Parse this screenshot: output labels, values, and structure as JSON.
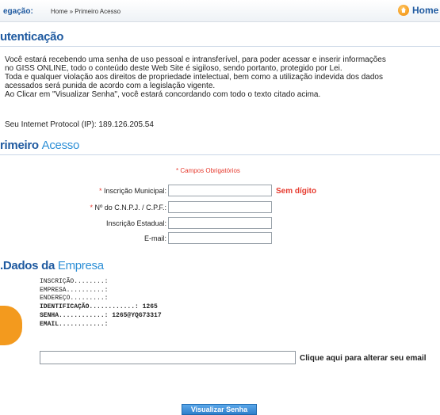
{
  "topbar": {
    "nav_label": "egação:",
    "breadcrumb": "Home » Primeiro Acesso",
    "home_label": "Home"
  },
  "auth": {
    "title": "utenticação",
    "paragraph_lines": [
      "Você estará recebendo uma senha de uso pessoal e intransferível, para poder acessar e inserir informações",
      "no GISS ONLINE, todo o conteúdo deste Web Site é sigiloso, sendo portanto, protegido por Lei.",
      "Toda e qualquer violação aos direitos de propriedade intelectual, bem como a utilização indevida dos dados",
      "acessados será punida de acordo com a legislação vigente.",
      "Ao Clicar em \"Visualizar Senha\", você estará concordando com todo o texto citado acima."
    ],
    "ip_text": "Seu Internet Protocol (IP): 189.126.205.54"
  },
  "primeiro": {
    "title_a": "rimeiro",
    "title_b": "Acesso",
    "required_note": "* Campos Obrigatórios",
    "fields": {
      "inscricao_municipal": {
        "label": "Inscrição Municipal:",
        "value": ""
      },
      "cnpj": {
        "label": "Nº do C.N.P.J. / C.P.F.:",
        "value": ""
      },
      "inscricao_estadual": {
        "label": "Inscrição Estadual:",
        "value": ""
      },
      "email": {
        "label": "E-mail:",
        "value": ""
      }
    },
    "sem_digito": "Sem dígito"
  },
  "empresa": {
    "title_a": ".Dados da",
    "title_b": "Empresa",
    "lines": {
      "inscricao": "INSCRIÇÃO........:",
      "empresa": "EMPRESA..........:",
      "endereco": "ENDEREÇO.........:",
      "identificacao": "IDENTIFICAÇÃO............: 1265",
      "senha": "SENHA............: 1265@YQG73317",
      "email": "EMAIL............:"
    },
    "email_input_value": "",
    "email_link": "Clique aqui para alterar seu email"
  },
  "actions": {
    "visualizar_senha": "Visualizar Senha"
  }
}
